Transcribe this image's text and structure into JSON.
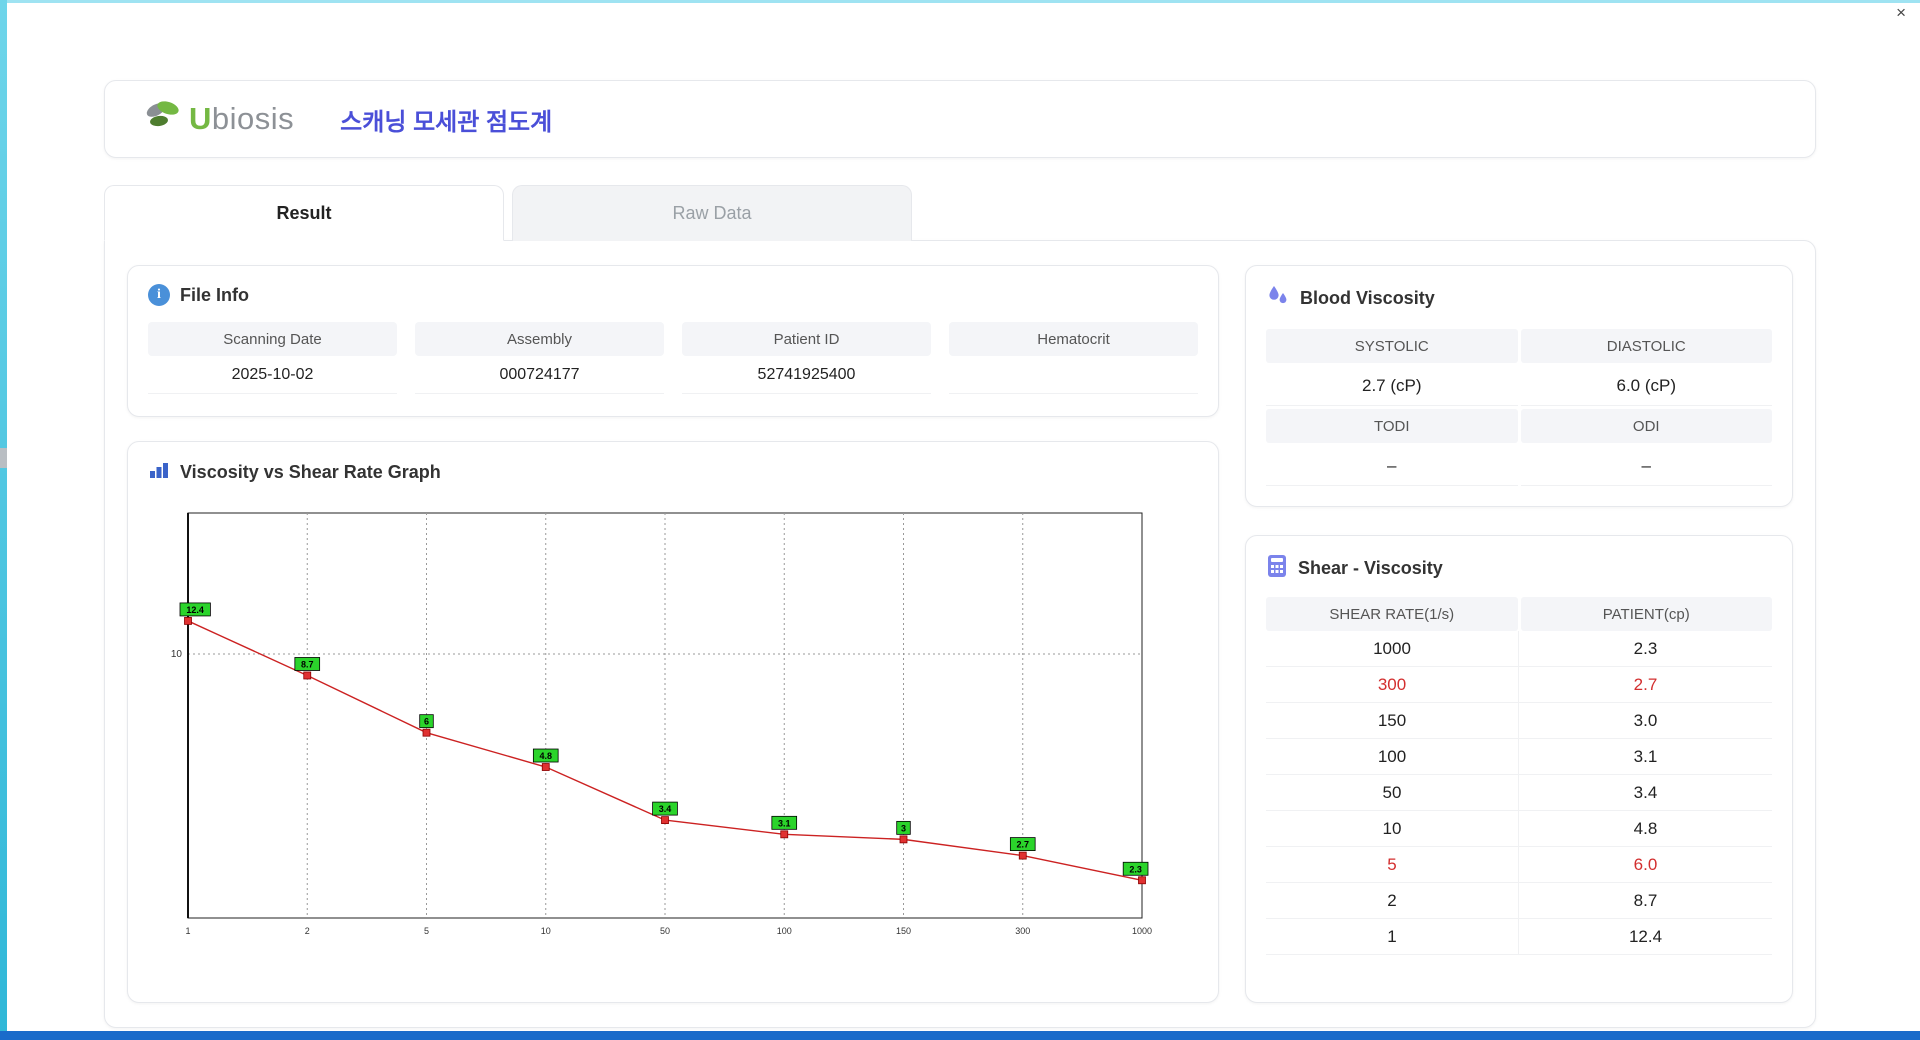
{
  "window": {
    "close_label": "×"
  },
  "header": {
    "brand_u": "U",
    "brand_rest": "biosis",
    "title": "스캐닝 모세관 점도계"
  },
  "tabs": [
    {
      "label": "Result",
      "active": true
    },
    {
      "label": "Raw Data",
      "active": false
    }
  ],
  "file_info": {
    "title": "File Info",
    "fields": [
      {
        "label": "Scanning Date",
        "value": "2025-10-02"
      },
      {
        "label": "Assembly",
        "value": "000724177"
      },
      {
        "label": "Patient ID",
        "value": "52741925400"
      },
      {
        "label": "Hematocrit",
        "value": ""
      }
    ]
  },
  "blood_viscosity": {
    "title": "Blood Viscosity",
    "rows": [
      {
        "headers": [
          "SYSTOLIC",
          "DIASTOLIC"
        ],
        "values": [
          "2.7 (cP)",
          "6.0 (cP)"
        ]
      },
      {
        "headers": [
          "TODI",
          "ODI"
        ],
        "values": [
          "–",
          "–"
        ]
      }
    ]
  },
  "graph": {
    "title": "Viscosity vs Shear Rate Graph"
  },
  "chart_data": {
    "type": "line",
    "title": "Viscosity vs Shear Rate Graph",
    "x": [
      1,
      2,
      5,
      10,
      50,
      100,
      150,
      300,
      1000
    ],
    "xscale": "categorical",
    "yscale": "log",
    "ylim": [
      1.8,
      25
    ],
    "yticks": [
      10
    ],
    "grid": true,
    "series": [
      {
        "name": "Patient",
        "values": [
          12.4,
          8.7,
          6,
          4.8,
          3.4,
          3.1,
          3,
          2.7,
          2.3
        ]
      }
    ],
    "point_labels": [
      "12.4",
      "8.7",
      "6",
      "4.8",
      "3.4",
      "3.1",
      "3",
      "2.7",
      "2.3"
    ]
  },
  "shear_table": {
    "title": "Shear - Viscosity",
    "columns": [
      "SHEAR RATE(1/s)",
      "PATIENT(cp)"
    ],
    "rows": [
      {
        "shear": "1000",
        "value": "2.3",
        "highlight": false
      },
      {
        "shear": "300",
        "value": "2.7",
        "highlight": true
      },
      {
        "shear": "150",
        "value": "3.0",
        "highlight": false
      },
      {
        "shear": "100",
        "value": "3.1",
        "highlight": false
      },
      {
        "shear": "50",
        "value": "3.4",
        "highlight": false
      },
      {
        "shear": "10",
        "value": "4.8",
        "highlight": false
      },
      {
        "shear": "5",
        "value": "6.0",
        "highlight": true
      },
      {
        "shear": "2",
        "value": "8.7",
        "highlight": false
      },
      {
        "shear": "1",
        "value": "12.4",
        "highlight": false
      }
    ]
  },
  "colors": {
    "accent_title": "#4a4fd8",
    "highlight_red": "#d32f2f",
    "chart_line": "#cc2222",
    "chart_marker": "#e03131",
    "chart_label_bg": "#2bd42b",
    "header_cell_bg": "#f4f5f8",
    "brand_green": "#74b843",
    "icon_purple": "#7b83eb",
    "icon_blue": "#4a90d9"
  }
}
